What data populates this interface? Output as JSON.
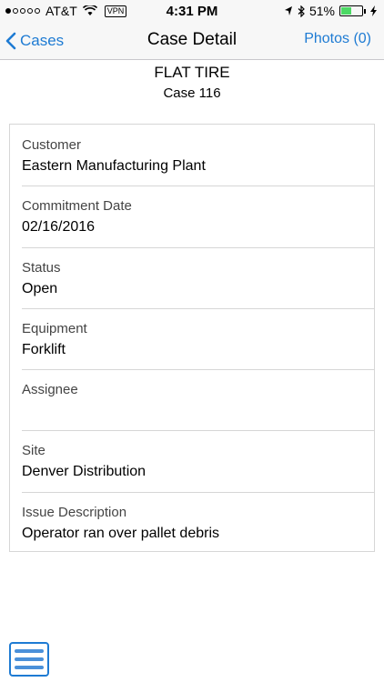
{
  "status_bar": {
    "carrier": "AT&T",
    "vpn": "VPN",
    "time": "4:31 PM",
    "battery": "51%",
    "battery_level": 0.51
  },
  "nav": {
    "back_label": "Cases",
    "title": "Case Detail",
    "photos_label": "Photos (0)"
  },
  "case": {
    "title": "FLAT TIRE",
    "number": "Case 116"
  },
  "fields": [
    {
      "label": "Customer",
      "value": "Eastern Manufacturing Plant"
    },
    {
      "label": "Commitment Date",
      "value": "02/16/2016"
    },
    {
      "label": "Status",
      "value": "Open"
    },
    {
      "label": "Equipment",
      "value": "Forklift"
    },
    {
      "label": "Assignee",
      "value": ""
    },
    {
      "label": "Site",
      "value": "Denver Distribution"
    },
    {
      "label": "Issue Description",
      "value": "Operator ran over pallet debris"
    }
  ],
  "colors": {
    "accent": "#1e7bd3",
    "battery": "#4cd964"
  },
  "icons": {
    "back": "chevron-left-icon",
    "menu": "hamburger-menu-icon"
  }
}
